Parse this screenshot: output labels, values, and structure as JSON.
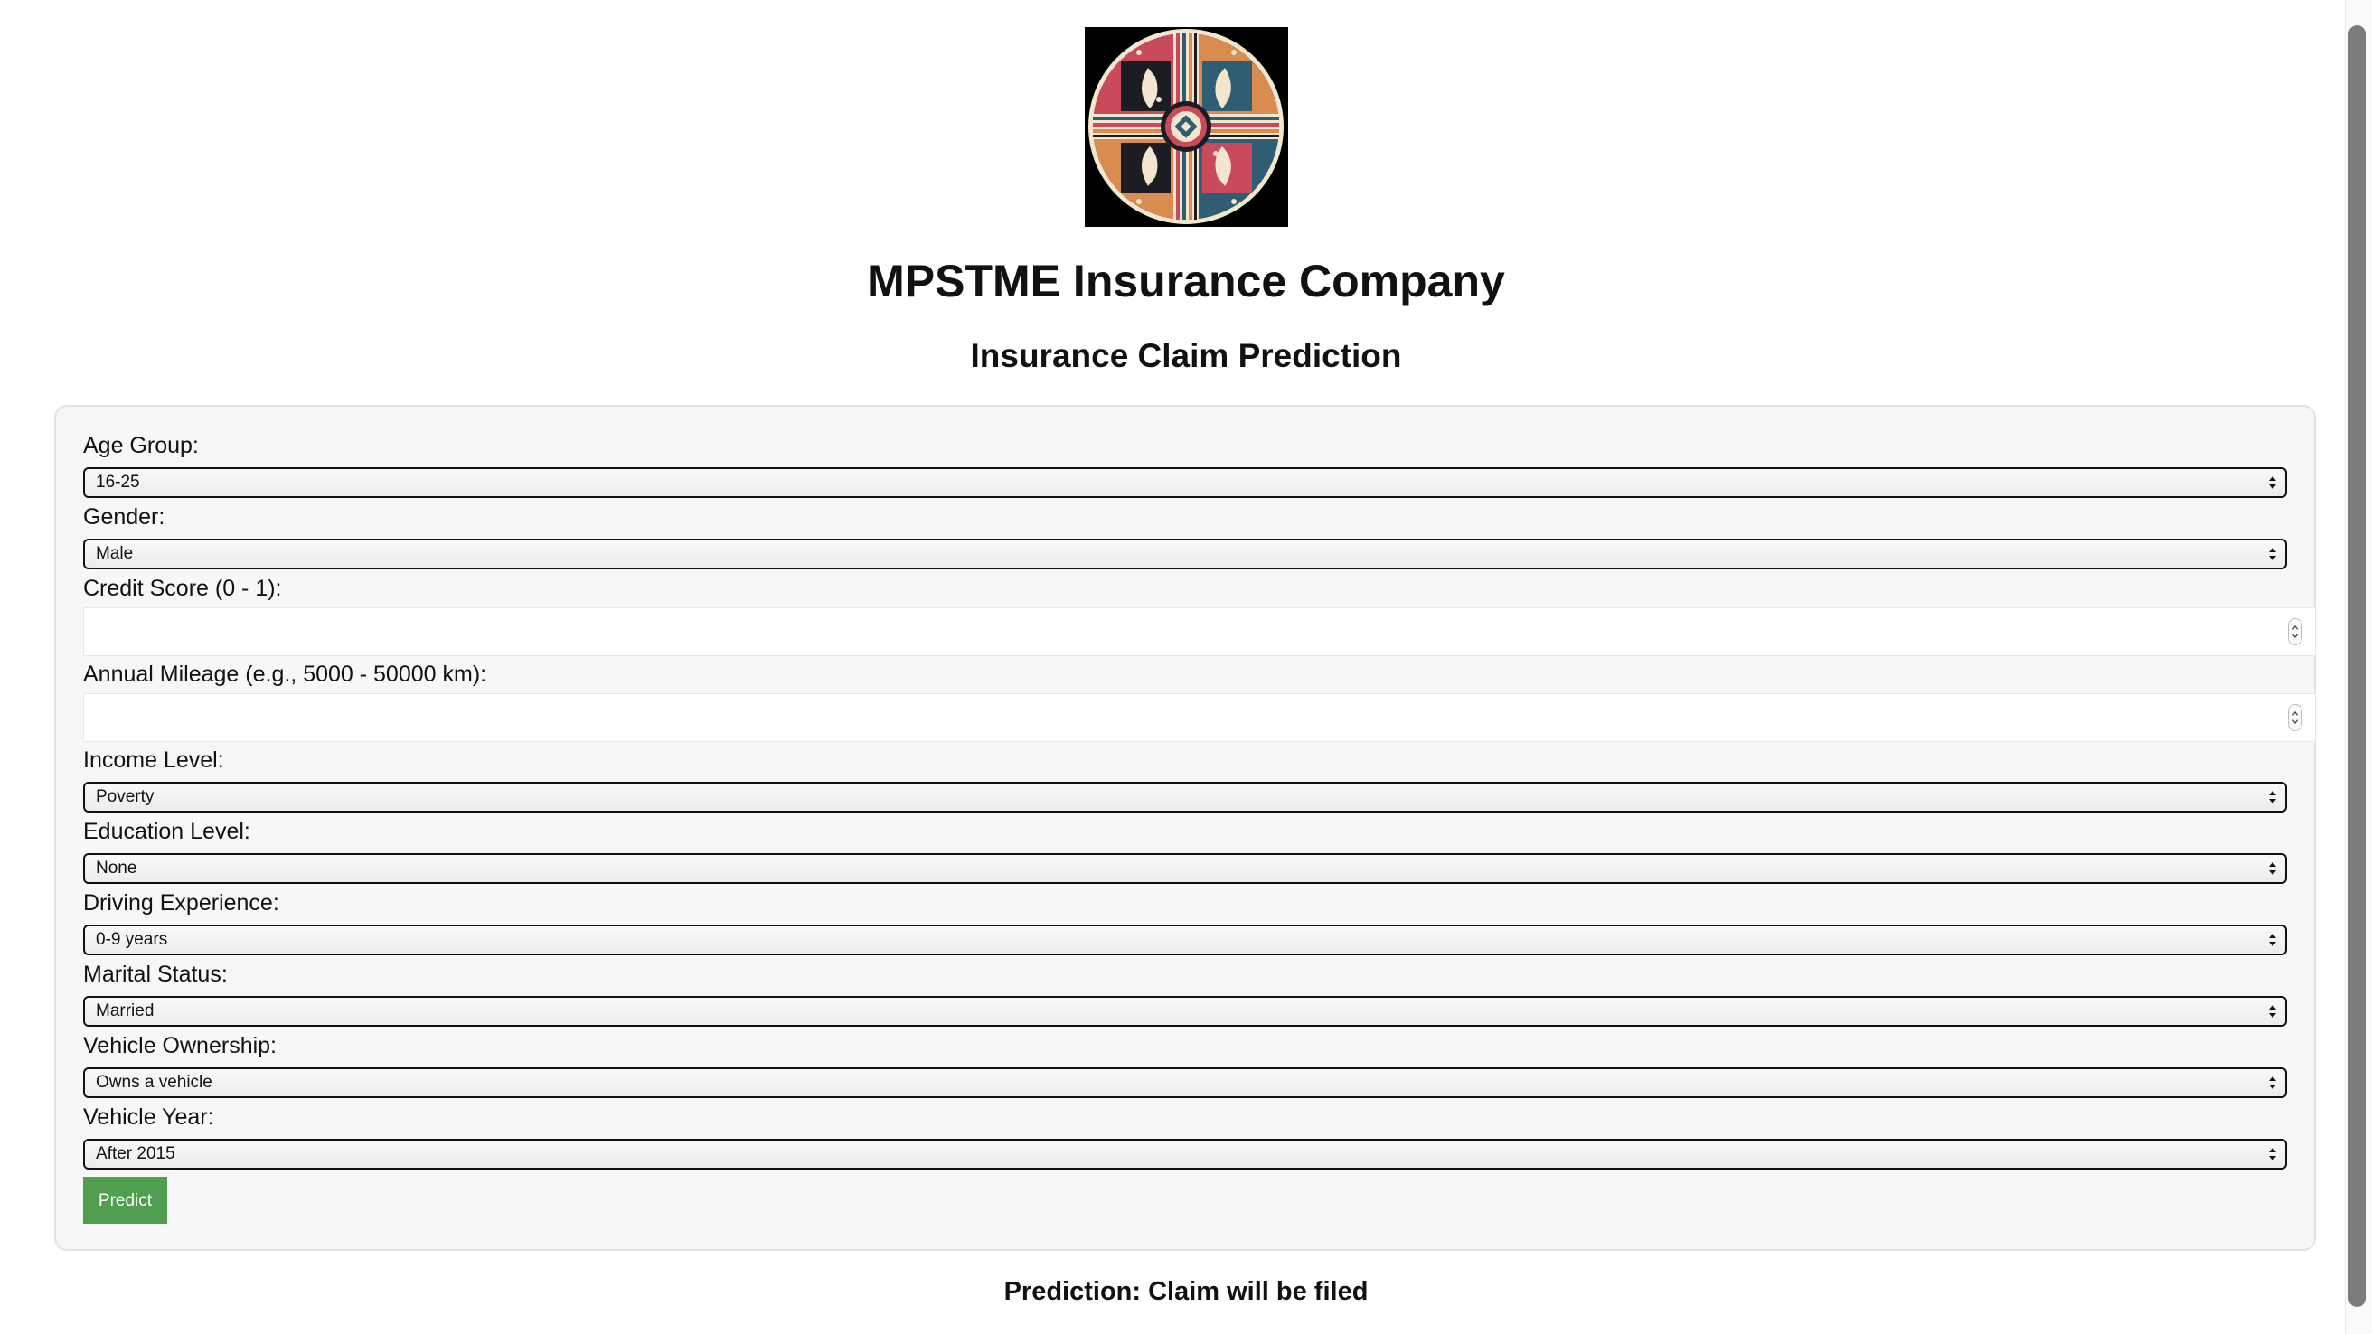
{
  "header": {
    "company_name": "MPSTME Insurance Company",
    "page_subtitle": "Insurance Claim Prediction"
  },
  "logo": {
    "icon": "logo-mandala-icon",
    "colors": [
      "#c94a5a",
      "#2f5d73",
      "#d98c4f",
      "#f3e6cf",
      "#1c1c24"
    ]
  },
  "form": {
    "age_group": {
      "label": "Age Group:",
      "value": "16-25"
    },
    "gender": {
      "label": "Gender:",
      "value": "Male"
    },
    "credit_score": {
      "label": "Credit Score (0 - 1):",
      "value": ""
    },
    "annual_mileage": {
      "label": "Annual Mileage (e.g., 5000 - 50000 km):",
      "value": ""
    },
    "income_level": {
      "label": "Income Level:",
      "value": "Poverty"
    },
    "education_level": {
      "label": "Education Level:",
      "value": "None"
    },
    "driving_experience": {
      "label": "Driving Experience:",
      "value": "0-9 years"
    },
    "marital_status": {
      "label": "Marital Status:",
      "value": "Married"
    },
    "vehicle_ownership": {
      "label": "Vehicle Ownership:",
      "value": "Owns a vehicle"
    },
    "vehicle_year": {
      "label": "Vehicle Year:",
      "value": "After 2015"
    },
    "submit_label": "Predict"
  },
  "result": {
    "text": "Prediction: Claim will be filed"
  },
  "colors": {
    "button_bg": "#4f9f4f",
    "panel_bg": "#f7f7f7",
    "panel_border": "#e2e2e2"
  }
}
